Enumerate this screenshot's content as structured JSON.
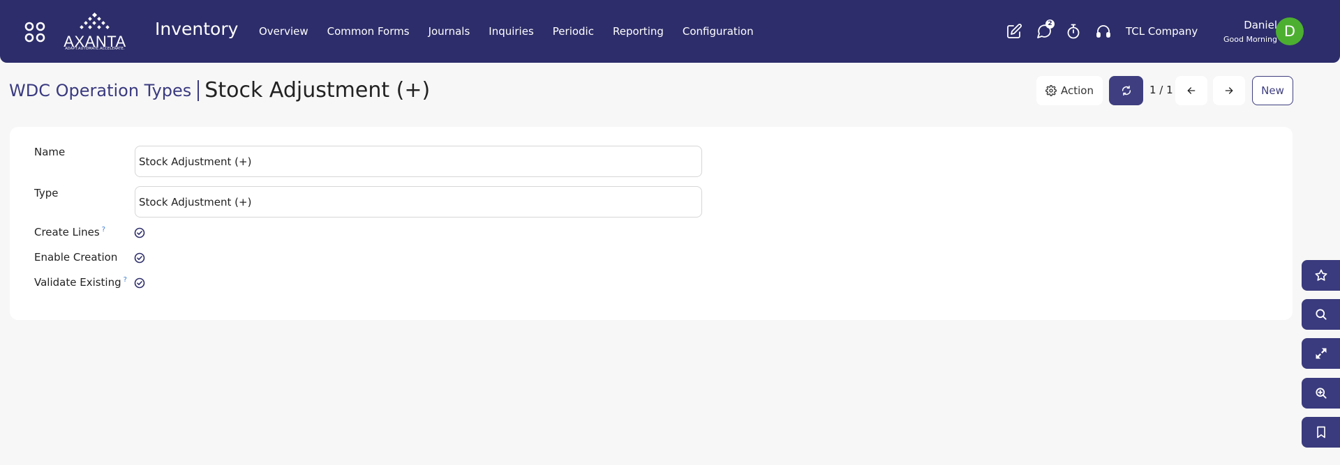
{
  "app": {
    "title": "Inventory",
    "logo_text": "AXANTA",
    "logo_tagline": "ADAPT.AUTOMATE.ACCELERATE."
  },
  "nav": {
    "items": [
      {
        "label": "Overview"
      },
      {
        "label": "Common Forms"
      },
      {
        "label": "Journals"
      },
      {
        "label": "Inquiries"
      },
      {
        "label": "Periodic"
      },
      {
        "label": "Reporting"
      },
      {
        "label": "Configuration"
      }
    ]
  },
  "header": {
    "icons": [
      "edit-icon",
      "chat-icon",
      "stopwatch-icon",
      "headset-icon"
    ],
    "chat_badge": "2",
    "company": "TCL Company",
    "user_name": "Daniel",
    "greeting": "Good Morning",
    "avatar_letter": "D",
    "avatar_color": "#4caf30"
  },
  "breadcrumb": {
    "parent": "WDC Operation Types",
    "current": "Stock Adjustment (+)"
  },
  "toolbar": {
    "action_label": "Action",
    "pager": "1 / 1",
    "new_label": "New"
  },
  "form": {
    "name_label": "Name",
    "name_value": "Stock Adjustment (+)",
    "type_label": "Type",
    "type_value": "Stock Adjustment (+)",
    "create_lines_label": "Create Lines",
    "create_lines_help": "?",
    "create_lines_checked": true,
    "enable_creation_label": "Enable Creation",
    "enable_creation_checked": true,
    "validate_existing_label": "Validate Existing",
    "validate_existing_help": "?",
    "validate_existing_checked": true
  },
  "side_buttons": [
    "star-icon",
    "search-icon",
    "expand-icon",
    "zoom-in-icon",
    "bookmark-icon"
  ],
  "colors": {
    "brand": "#2d2d6b",
    "accent": "#3e3e80",
    "background": "#f7f7f7"
  }
}
